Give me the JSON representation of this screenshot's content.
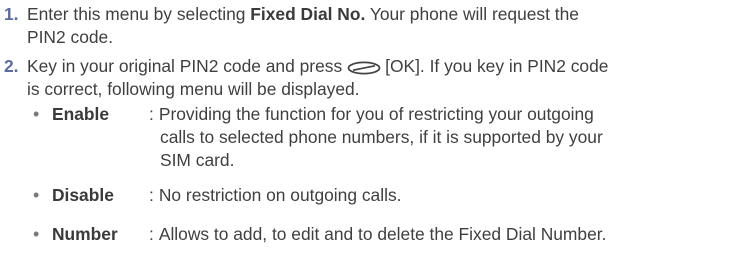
{
  "steps": [
    {
      "number": "1.",
      "text_prefix": "Enter this menu by selecting ",
      "text_bold": "Fixed Dial No.",
      "text_suffix": " Your phone will request the",
      "line2": "PIN2 code."
    },
    {
      "number": "2.",
      "text_prefix": "Key in your original PIN2 code and press",
      "key_icon": "ok-soft-key-icon",
      "text_after_key": "[OK]. If you key in PIN2 code",
      "line2": "is correct, following menu will be displayed."
    }
  ],
  "options": [
    {
      "name": "Enable",
      "colon": ":",
      "lines": [
        "Providing the function for you of restricting your outgoing",
        "calls to selected phone numbers, if it is supported by your",
        "SIM card."
      ]
    },
    {
      "name": "Disable",
      "colon": ":",
      "lines": [
        "No restriction on outgoing calls."
      ]
    },
    {
      "name": "Number",
      "colon": ":",
      "lines": [
        "Allows to add, to edit and to delete the Fixed Dial Number."
      ]
    }
  ],
  "bullet_char": "•",
  "colors": {
    "step_number": "#5c6a9e",
    "text": "#3f3f3f"
  }
}
